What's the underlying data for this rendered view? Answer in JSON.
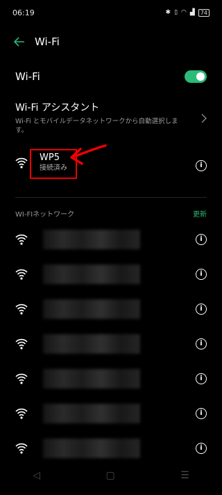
{
  "status": {
    "time": "06:19",
    "icons": "✱ ᯤ ⅕ ▲▲ ⅟",
    "battery": "74"
  },
  "header": {
    "title": "Wi-Fi"
  },
  "wifi_toggle": {
    "label": "Wi-Fi",
    "enabled": true
  },
  "assistant": {
    "title": "Wi-Fi アシスタント",
    "subtitle": "Wi-Fi とモバイルデータネットワークから自動選択します。"
  },
  "connected": {
    "name": "WP5",
    "status": "接続済み"
  },
  "networks_section": {
    "title": "WI-FIネットワーク",
    "refresh": "更新"
  },
  "networks": [
    {
      "name": ""
    },
    {
      "name": ""
    },
    {
      "name": ""
    },
    {
      "name": ""
    },
    {
      "name": ""
    },
    {
      "name": ""
    },
    {
      "name": ""
    }
  ],
  "colors": {
    "accent": "#2bba77",
    "annotation": "#e00000"
  }
}
